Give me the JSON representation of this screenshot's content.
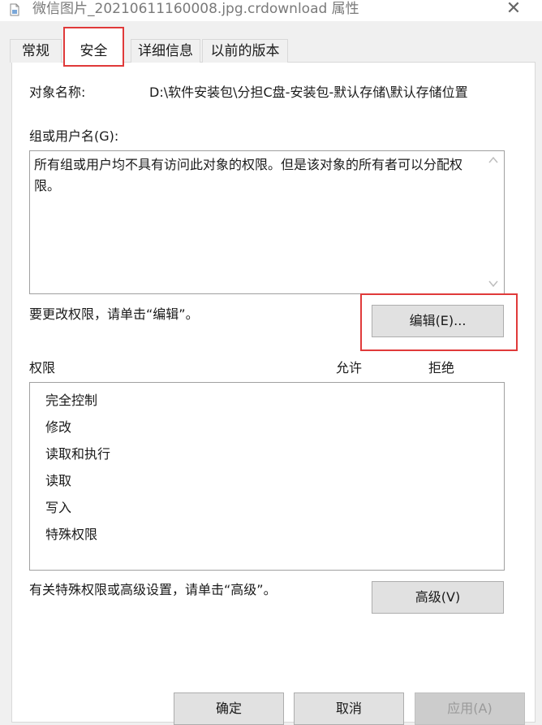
{
  "window": {
    "title": "微信图片_20210611160008.jpg.crdownload 属性",
    "close_glyph": "✕"
  },
  "tabs": [
    {
      "label": "常规"
    },
    {
      "label": "安全"
    },
    {
      "label": "详细信息"
    },
    {
      "label": "以前的版本"
    }
  ],
  "security": {
    "object_name_label": "对象名称:",
    "object_path": "D:\\软件安装包\\分担C盘-安装包-默认存储\\默认存储位置",
    "group_label": "组或用户名(G):",
    "group_message": "所有组或用户均不具有访问此对象的权限。但是该对象的所有者可以分配权限。",
    "edit_hint": "要更改权限，请单击“编辑”。",
    "edit_button": "编辑(E)...",
    "permissions_label": "权限",
    "allow_label": "允许",
    "deny_label": "拒绝",
    "permissions": [
      "完全控制",
      "修改",
      "读取和执行",
      "读取",
      "写入",
      "特殊权限"
    ],
    "advanced_hint": "有关特殊权限或高级设置，请单击“高级”。",
    "advanced_button": "高级(V)"
  },
  "footer": {
    "ok": "确定",
    "cancel": "取消",
    "apply": "应用(A)"
  },
  "colors": {
    "highlight": "#e03a3a"
  }
}
